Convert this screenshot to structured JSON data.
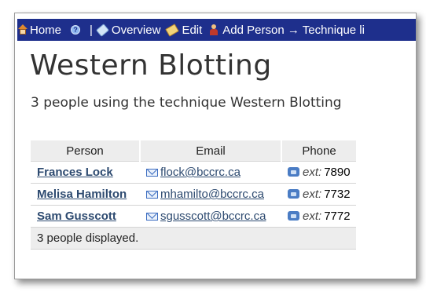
{
  "nav": {
    "home": "Home",
    "sep": "|",
    "overview": "Overview",
    "edit": "Edit",
    "add_person": "Add Person → Technique li"
  },
  "page": {
    "title": "Western Blotting",
    "subtitle": "3 people using the technique Western Blotting"
  },
  "table": {
    "columns": [
      "Person",
      "Email",
      "Phone"
    ],
    "rows": [
      {
        "name": "Frances Lock",
        "email": "flock@bccrc.ca",
        "ext_label": "ext:",
        "ext": "7890"
      },
      {
        "name": "Melisa Hamilton",
        "email": "mhamilto@bccrc.ca",
        "ext_label": "ext:",
        "ext": "7732"
      },
      {
        "name": "Sam Gusscott",
        "email": "sgusscott@bccrc.ca",
        "ext_label": "ext:",
        "ext": "7772"
      }
    ],
    "footer": "3 people displayed."
  },
  "icons": {
    "home": "home-icon",
    "help": "help-icon",
    "overview": "tag-icon",
    "edit": "edit-icon",
    "add_person": "person-icon",
    "email": "mail-icon",
    "phone": "phone-icon"
  },
  "colors": {
    "navbar": "#1e2f8c",
    "link": "#2d4a70",
    "table_header": "#ededed"
  }
}
